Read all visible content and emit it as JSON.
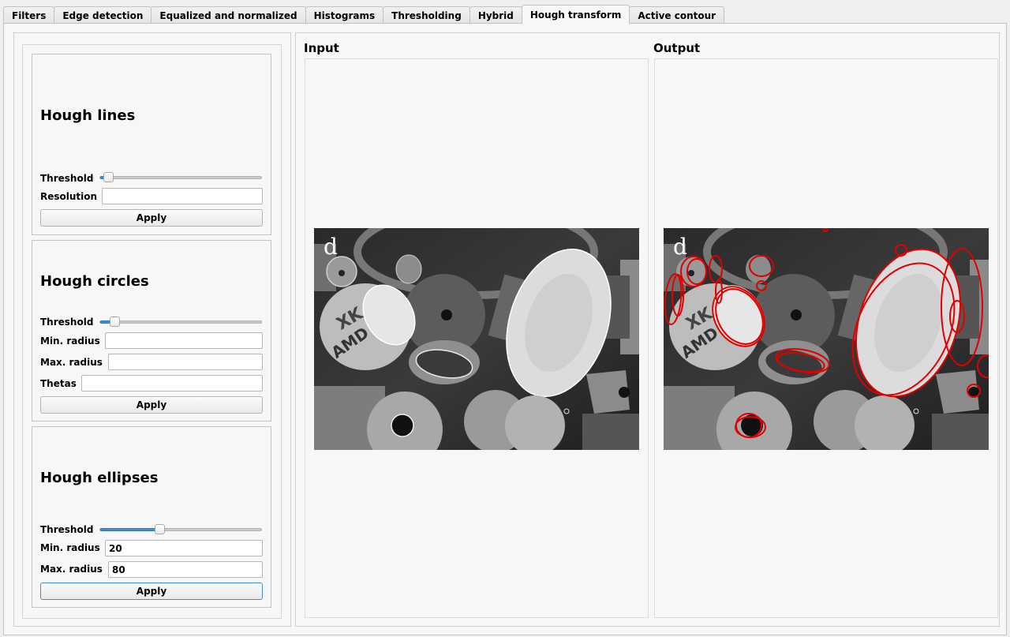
{
  "tabs": [
    {
      "label": "Filters",
      "active": false
    },
    {
      "label": "Edge detection",
      "active": false
    },
    {
      "label": "Equalized and normalized",
      "active": false
    },
    {
      "label": "Histograms",
      "active": false
    },
    {
      "label": "Thresholding",
      "active": false
    },
    {
      "label": "Hybrid",
      "active": false
    },
    {
      "label": "Hough transform",
      "active": true
    },
    {
      "label": "Active contour",
      "active": false
    }
  ],
  "hough_lines": {
    "title": "Hough lines",
    "threshold_label": "Threshold",
    "threshold_value": 0.05,
    "resolution_label": "Resolution",
    "resolution_value": "",
    "apply_label": "Apply"
  },
  "hough_circles": {
    "title": "Hough circles",
    "threshold_label": "Threshold",
    "threshold_value": 0.09,
    "min_radius_label": "Min. radius",
    "min_radius_value": "",
    "max_radius_label": "Max. radius",
    "max_radius_value": "",
    "thetas_label": "Thetas",
    "thetas_value": "",
    "apply_label": "Apply"
  },
  "hough_ellipses": {
    "title": "Hough ellipses",
    "threshold_label": "Threshold",
    "threshold_value": 0.37,
    "min_radius_label": "Min. radius",
    "min_radius_value": "20",
    "max_radius_label": "Max. radius",
    "max_radius_value": "80",
    "apply_label": "Apply"
  },
  "input_panel": {
    "label": "Input",
    "image_letter": "d"
  },
  "output_panel": {
    "label": "Output",
    "image_letter": "d"
  },
  "colors": {
    "accent": "#3f8fd0",
    "detection": "#e00000"
  }
}
